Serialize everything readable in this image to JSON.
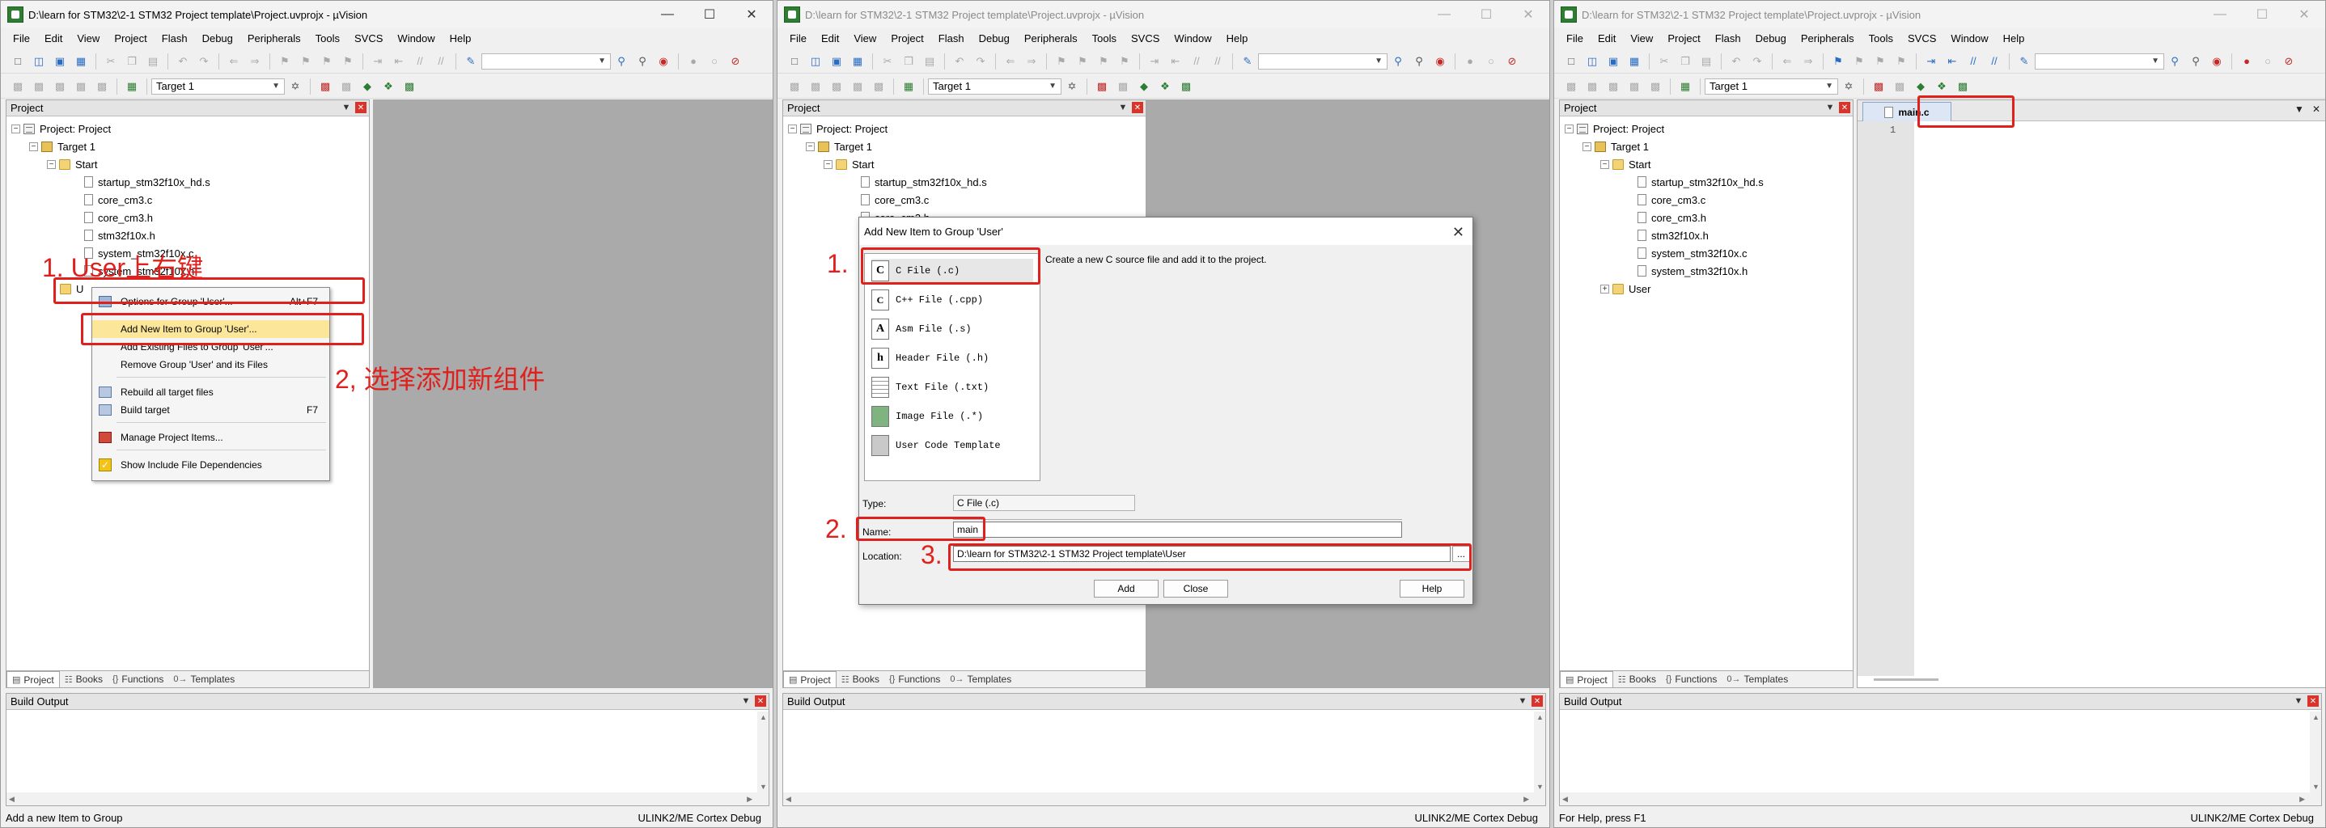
{
  "windows": [
    {
      "title": "D:\\learn for STM32\\2-1 STM32 Project template\\Project.uvprojx - µVision",
      "status_left": "Add a new Item to Group",
      "status_right": "ULINK2/ME Cortex Debug"
    },
    {
      "title": "D:\\learn for STM32\\2-1 STM32 Project template\\Project.uvprojx - µVision",
      "status_left": "",
      "status_right": "ULINK2/ME Cortex Debug"
    },
    {
      "title": "D:\\learn for STM32\\2-1 STM32 Project template\\Project.uvprojx - µVision",
      "status_left": "For Help, press F1",
      "status_right": "ULINK2/ME Cortex Debug"
    }
  ],
  "menu": [
    "File",
    "Edit",
    "View",
    "Project",
    "Flash",
    "Debug",
    "Peripherals",
    "Tools",
    "SVCS",
    "Window",
    "Help"
  ],
  "toolbar": {
    "target_name": "Target 1"
  },
  "project_pane": {
    "header": "Project",
    "root": "Project: Project",
    "target": "Target 1",
    "group_start": "Start",
    "files": [
      "startup_stm32f10x_hd.s",
      "core_cm3.c",
      "core_cm3.h",
      "stm32f10x.h",
      "system_stm32f10x.c",
      "system_stm32f10x.h"
    ],
    "group_user": "User",
    "group_user_partial": "U"
  },
  "pane_tabs": [
    "Project",
    "Books",
    "Functions",
    "Templates"
  ],
  "build_output": {
    "header": "Build Output"
  },
  "context_menu": {
    "items": [
      {
        "label": "Options for Group 'User'...",
        "shortcut": "Alt+F7"
      },
      {
        "label": "Add New  Item to Group 'User'...",
        "shortcut": ""
      },
      {
        "label": "Add Existing Files to Group 'User'...",
        "shortcut": ""
      },
      {
        "label": "Remove Group 'User' and its Files",
        "shortcut": ""
      },
      {
        "label": "Rebuild all target files",
        "shortcut": ""
      },
      {
        "label": "Build target",
        "shortcut": "F7"
      },
      {
        "label": "Manage Project Items...",
        "shortcut": ""
      },
      {
        "label": "Show Include File Dependencies",
        "shortcut": ""
      }
    ]
  },
  "annotations": {
    "step1_left": "1. User上右键",
    "step2_left": "2, 选择添加新组件",
    "step1_mid": "1.",
    "step2_mid": "2.",
    "step3_mid": "3."
  },
  "dialog": {
    "title": "Add New Item to Group 'User'",
    "description": "Create a new C source file and add it to the project.",
    "file_types": [
      {
        "icon": "C",
        "label": "C File (.c)"
      },
      {
        "icon": "C",
        "label": "C++ File (.cpp)"
      },
      {
        "icon": "A",
        "label": "Asm File (.s)"
      },
      {
        "icon": "h",
        "label": "Header File (.h)"
      },
      {
        "icon": "",
        "label": "Text File (.txt)"
      },
      {
        "icon": "",
        "label": "Image File (.*)"
      },
      {
        "icon": "",
        "label": "User Code Template"
      }
    ],
    "type_label": "Type:",
    "type_value": "C File (.c)",
    "name_label": "Name:",
    "name_value": "main",
    "location_label": "Location:",
    "location_value": "D:\\learn for STM32\\2-1 STM32 Project template\\User",
    "browse": "...",
    "add_button": "Add",
    "close_button": "Close",
    "help_button": "Help"
  },
  "editor": {
    "tab": "main.c",
    "line_number": "1"
  }
}
